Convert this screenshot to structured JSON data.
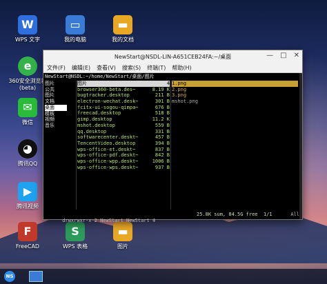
{
  "desktop": {
    "icons": [
      {
        "label": "WPS 文字",
        "glyph": "W",
        "color": "#2f6fdd",
        "icon": "wps-writer-icon"
      },
      {
        "label": "我的电脑",
        "glyph": "▭",
        "color": "#3b7bd8",
        "icon": "computer-icon"
      },
      {
        "label": "我的文档",
        "glyph": "▬",
        "color": "#e8a826",
        "icon": "folder-icon"
      },
      {
        "label": "360安全浏览器(beta)",
        "glyph": "e",
        "color": "#35b24a",
        "icon": "browser-360-icon"
      },
      {
        "label": "微信",
        "glyph": "✉",
        "color": "#2bbb3b",
        "icon": "wechat-icon"
      },
      {
        "label": "腾讯QQ",
        "glyph": "◕",
        "color": "#111111",
        "icon": "qq-icon"
      },
      {
        "label": "腾讯视频",
        "glyph": "▶",
        "color": "#1fa3f0",
        "icon": "tencent-video-icon"
      },
      {
        "label": "FreeCAD",
        "glyph": "F",
        "color": "#c0392b",
        "icon": "freecad-icon"
      },
      {
        "label": "WPS 表格",
        "glyph": "S",
        "color": "#2c9a5a",
        "icon": "wps-spreadsheet-icon"
      },
      {
        "label": "图片",
        "glyph": "▬",
        "color": "#e8a826",
        "icon": "pictures-folder-icon"
      }
    ]
  },
  "window": {
    "title": "NewStart@NSDL-LIN-A651CEB24FA:~/桌面",
    "buttons": {
      "minimize": "—",
      "maximize": "□",
      "close": "✕"
    },
    "menu": [
      "文件(F)",
      "编辑(E)",
      "查看(V)",
      "搜索(S)",
      "终端(T)",
      "帮助(H)"
    ]
  },
  "terminal": {
    "path": "NewStart@NSDL:~/home/NewStart/桌面/图片",
    "dirs": [
      "图片",
      "公共",
      "图片",
      "文档",
      "桌面",
      "模板",
      "视频",
      "音乐"
    ],
    "dir_selected_index": 4,
    "files": [
      {
        "name": "图片",
        "size": "4",
        "highlight": true
      },
      {
        "name": "browser360-beta.des~",
        "size": "8.19 K"
      },
      {
        "name": "bugtracker.desktop",
        "size": "211 B"
      },
      {
        "name": "electron-wechat.desk~",
        "size": "301 B"
      },
      {
        "name": "fcitx-ui-sogou-qimpa~",
        "size": "676 B"
      },
      {
        "name": "freecad.desktop",
        "size": "518 B"
      },
      {
        "name": "gimp.desktop",
        "size": "11.2 K"
      },
      {
        "name": "mshot.desktop",
        "size": "559 B"
      },
      {
        "name": "qq.desktop",
        "size": "331 B"
      },
      {
        "name": "softwarecenter.deskt~",
        "size": "457 B"
      },
      {
        "name": "TencentVideo.desktop",
        "size": "394 B"
      },
      {
        "name": "wps-office-et.deskt~",
        "size": "837 B"
      },
      {
        "name": "wps-office-pdf.deskt~",
        "size": "842 B"
      },
      {
        "name": "wps-office-wpp.deskt~",
        "size": "1006 B"
      },
      {
        "name": "wps-office-wps.deskt~",
        "size": "937 B"
      }
    ],
    "preview": [
      {
        "name": "1.png",
        "highlight": true
      },
      {
        "name": "2.png"
      },
      {
        "name": "3.png"
      },
      {
        "name": "mshot.png",
        "gray": true
      }
    ],
    "status_left": "drwxrwxr-x 2 NewStart NewStart 4",
    "status_mid": "25.8K sum, 84.5G free",
    "status_page": "1/1",
    "status_right": "All"
  },
  "taskbar": {
    "start_label": "NS"
  }
}
